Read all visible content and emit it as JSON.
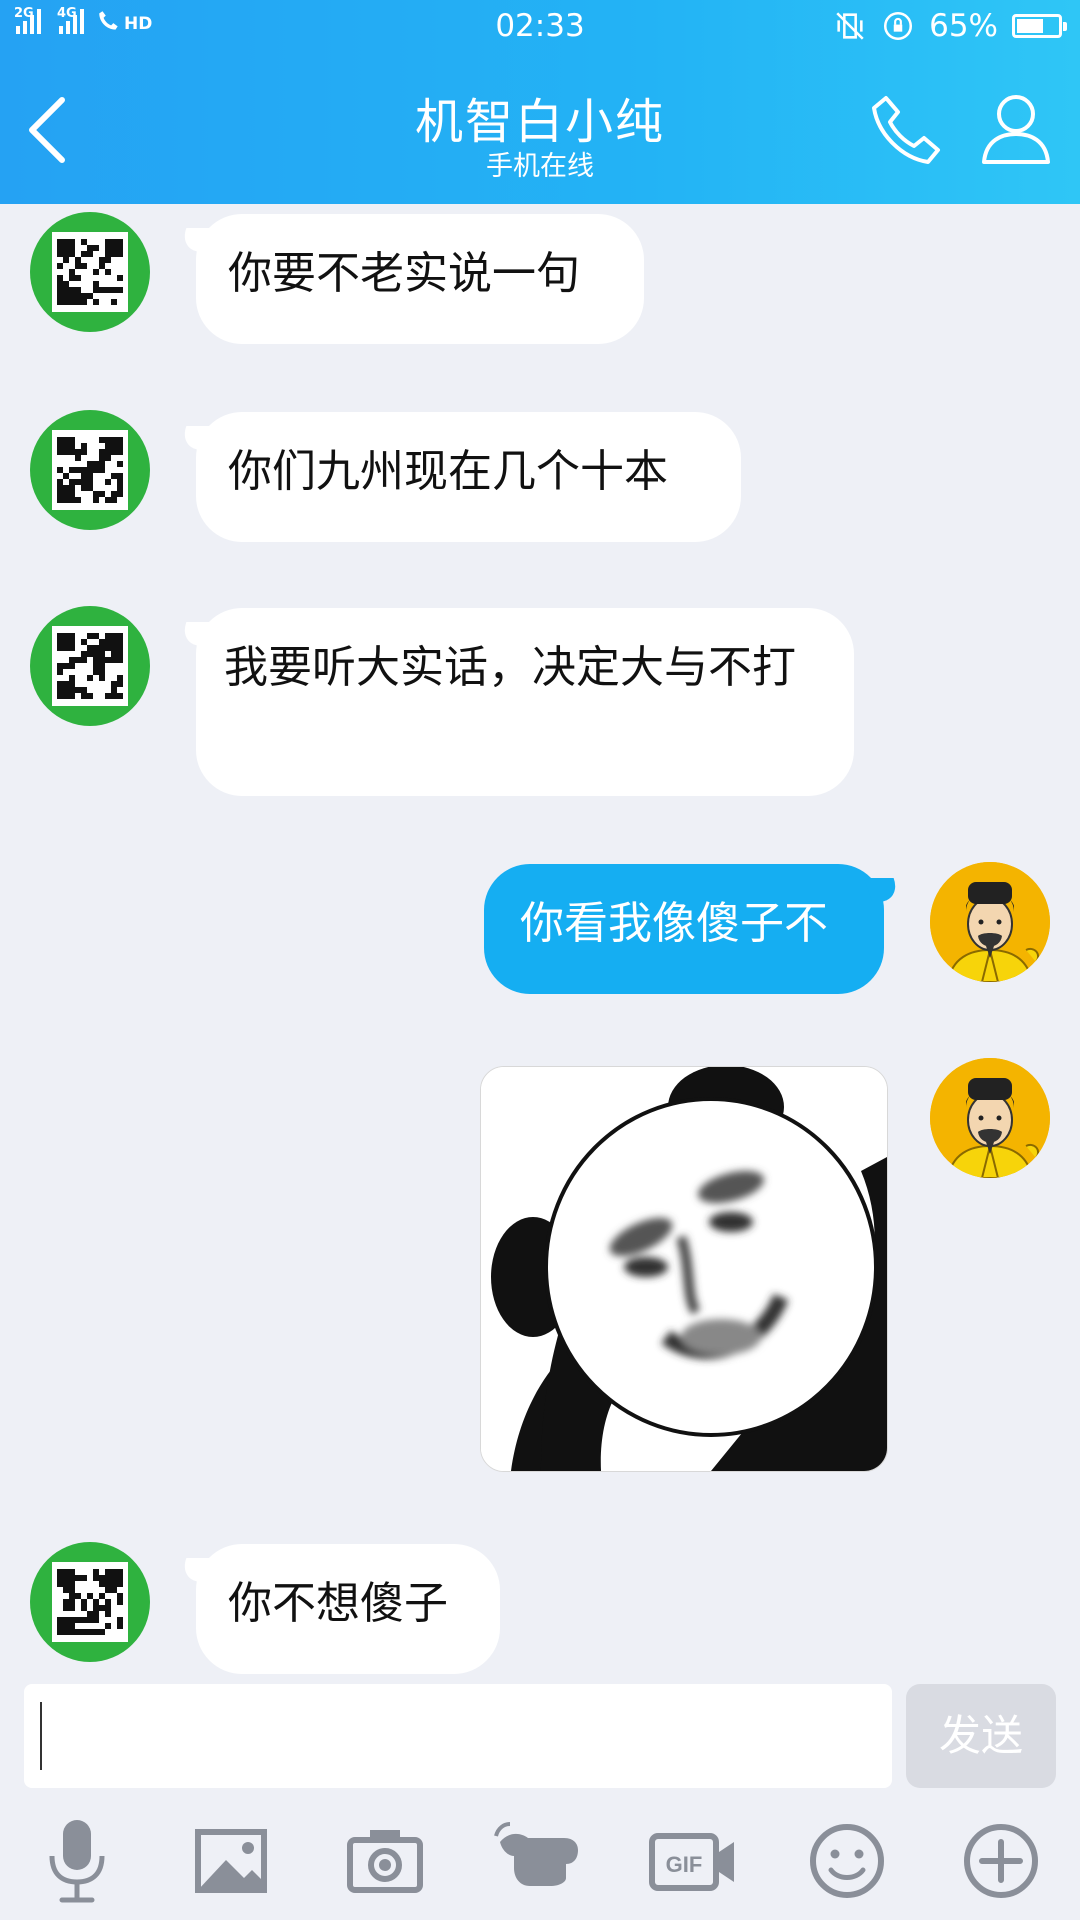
{
  "status_bar": {
    "network_1": "2G",
    "network_2": "4G",
    "hd": "HD",
    "time": "02:33",
    "battery_percent": "65%",
    "battery_level": 0.65
  },
  "header": {
    "title": "机智白小纯",
    "subtitle": "手机在线",
    "colors": {
      "gradient_start": "#25a2f3",
      "gradient_end": "#2fc6f6"
    }
  },
  "messages": [
    {
      "side": "left",
      "type": "text",
      "text": "你要不老实说一句"
    },
    {
      "side": "left",
      "type": "text",
      "text": "你们九州现在几个十本"
    },
    {
      "side": "left",
      "type": "text",
      "text": "我要听大实话，决定大与不打"
    },
    {
      "side": "right",
      "type": "text",
      "text": "你看我像傻子不"
    },
    {
      "side": "right",
      "type": "sticker",
      "sticker": "panda-meme-face"
    },
    {
      "side": "left",
      "type": "text",
      "text": "你不想傻子"
    }
  ],
  "input": {
    "value": "",
    "send_label": "发送"
  },
  "toolbar": {
    "icons": [
      "microphone-icon",
      "image-icon",
      "camera-icon",
      "poke-icon",
      "gif-icon",
      "emoji-icon",
      "plus-icon"
    ]
  },
  "colors": {
    "background": "#eef0f6",
    "outgoing_bubble": "#15aef2",
    "incoming_bubble": "#ffffff"
  }
}
